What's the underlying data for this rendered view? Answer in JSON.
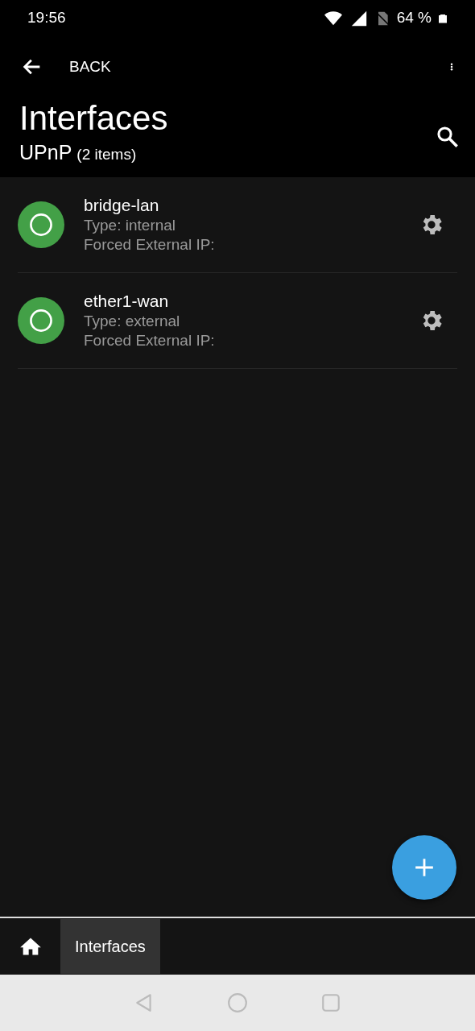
{
  "status_bar": {
    "time": "19:56",
    "battery": "64 %"
  },
  "toolbar": {
    "back_label": "BACK"
  },
  "header": {
    "title": "Interfaces",
    "subtitle": "UPnP",
    "count": "(2 items)"
  },
  "interfaces": [
    {
      "name": "bridge-lan",
      "type": "Type: internal",
      "forced_ip": "Forced External IP:"
    },
    {
      "name": "ether1-wan",
      "type": "Type: external",
      "forced_ip": "Forced External IP:"
    }
  ],
  "breadcrumbs": [
    {
      "label": "Interfaces",
      "selected": true
    }
  ]
}
